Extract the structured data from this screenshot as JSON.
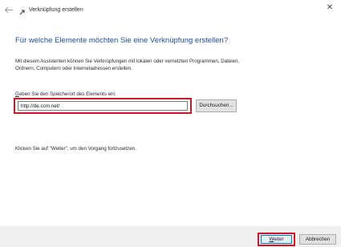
{
  "window": {
    "title": "Verknüpfung erstellen",
    "close_symbol": "✕",
    "back_icon": "back-arrow-icon",
    "app_icon": "shortcut-icon"
  },
  "main": {
    "heading": "Für welche Elemente möchten Sie eine Verknüpfung erstellen?",
    "description": "Mit diesem Assistenten können Sie Verknüpfungen mit lokalen oder vernetzten Programmen, Dateien, Ordnern, Computern oder Internetadressen erstellen.",
    "location_label_first": "G",
    "location_label_rest": "eben Sie den Speicherort des Elements ein:",
    "location_value": "http://de.ccm.net/",
    "browse_label": "Durchsuchen...",
    "hint": "Klicken Sie auf \"Weiter\", um den Vorgang fortzusetzen."
  },
  "footer": {
    "next_first": "W",
    "next_rest": "eiter",
    "cancel_label": "Abbrechen"
  },
  "colors": {
    "heading": "#1a4d9c",
    "highlight": "#d4141f",
    "footer_bg": "#f0f0f0"
  }
}
